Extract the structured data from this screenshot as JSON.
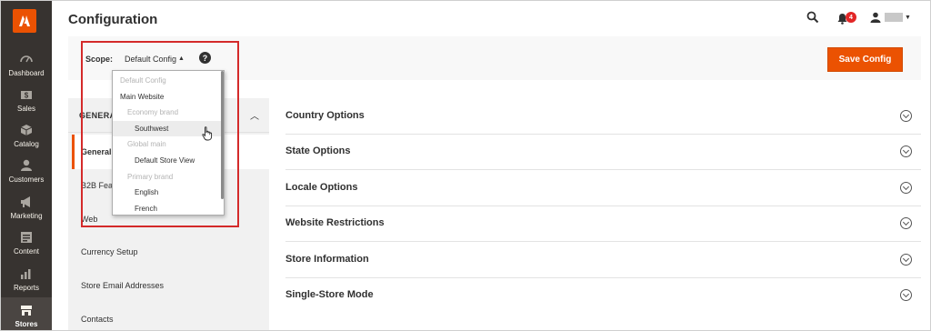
{
  "header": {
    "title": "Configuration",
    "notification_count": "4"
  },
  "leftnav": {
    "items": [
      {
        "label": "Dashboard",
        "icon": "gauge-icon"
      },
      {
        "label": "Sales",
        "icon": "dollar-icon"
      },
      {
        "label": "Catalog",
        "icon": "box-icon"
      },
      {
        "label": "Customers",
        "icon": "user-icon"
      },
      {
        "label": "Marketing",
        "icon": "megaphone-icon"
      },
      {
        "label": "Content",
        "icon": "layout-icon"
      },
      {
        "label": "Reports",
        "icon": "bar-chart-icon"
      },
      {
        "label": "Stores",
        "icon": "store-icon"
      }
    ],
    "active": "Stores"
  },
  "scope": {
    "label": "Scope:",
    "value": "Default Config",
    "help": "?",
    "options": [
      {
        "label": "Default Config",
        "disabled": true,
        "indent": 0
      },
      {
        "label": "Main Website",
        "disabled": false,
        "indent": 0
      },
      {
        "label": "Economy brand",
        "disabled": true,
        "indent": 1
      },
      {
        "label": "Southwest",
        "disabled": false,
        "indent": 2,
        "hover": true
      },
      {
        "label": "Global main",
        "disabled": true,
        "indent": 1
      },
      {
        "label": "Default Store View",
        "disabled": false,
        "indent": 2
      },
      {
        "label": "Primary brand",
        "disabled": true,
        "indent": 1
      },
      {
        "label": "English",
        "disabled": false,
        "indent": 2
      },
      {
        "label": "French",
        "disabled": false,
        "indent": 2
      }
    ]
  },
  "toolbar": {
    "save_label": "Save Config"
  },
  "config_nav": {
    "group_title": "GENERAL",
    "tabs": [
      "General",
      "B2B Features",
      "Web",
      "Currency Setup",
      "Store Email Addresses",
      "Contacts"
    ],
    "active_tab": "General"
  },
  "sections": [
    "Country Options",
    "State Options",
    "Locale Options",
    "Website Restrictions",
    "Store Information",
    "Single-Store Mode"
  ],
  "colors": {
    "accent": "#eb5202",
    "nav_bg": "#373330",
    "highlight": "#d42a2a"
  }
}
